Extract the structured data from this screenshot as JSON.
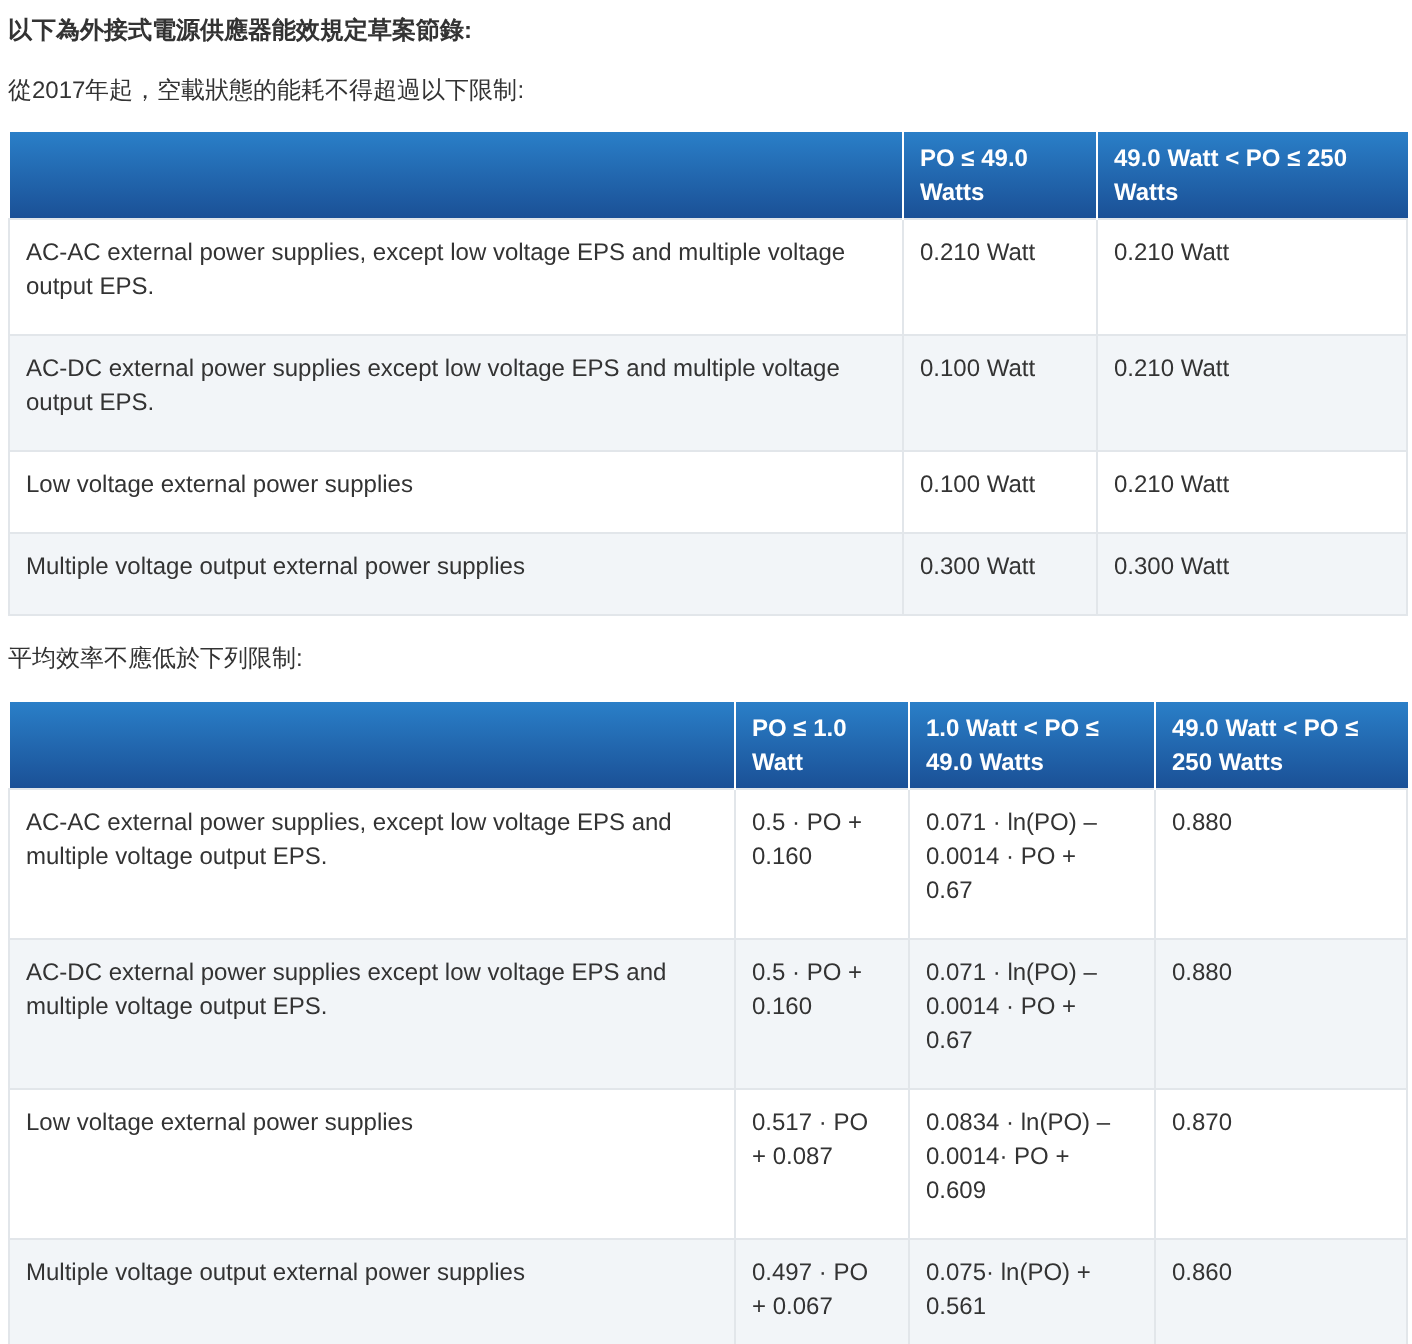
{
  "heading": "以下為外接式電源供應器能效規定草案節錄:",
  "sections": [
    {
      "caption": "從2017年起，空載狀態的能耗不得超過以下限制:",
      "table": {
        "columns": [
          "",
          "PO ≤ 49.0 Watts",
          "49.0 Watt < PO ≤ 250 Watts"
        ],
        "rows": [
          [
            "AC-AC external power supplies, except low voltage EPS and multiple voltage output EPS.",
            "0.210 Watt",
            "0.210 Watt"
          ],
          [
            "AC-DC external power supplies except low voltage EPS and multiple voltage output EPS.",
            "0.100 Watt",
            "0.210 Watt"
          ],
          [
            "Low voltage external power supplies",
            "0.100 Watt",
            "0.210 Watt"
          ],
          [
            "Multiple voltage output external power supplies",
            "0.300 Watt",
            "0.300 Watt"
          ]
        ]
      }
    },
    {
      "caption": "平均效率不應低於下列限制:",
      "table": {
        "columns": [
          "",
          "PO ≤ 1.0 Watt",
          "1.0 Watt < PO ≤ 49.0 Watts",
          "49.0 Watt < PO ≤ 250 Watts"
        ],
        "rows": [
          [
            "AC-AC external power supplies, except low voltage EPS and multiple voltage output EPS.",
            "0.5 · PO + 0.160",
            "0.071 · ln(PO) – 0.0014 · PO + 0.67",
            "0.880"
          ],
          [
            "AC-DC external power supplies except low voltage EPS and multiple voltage output EPS.",
            "0.5 · PO + 0.160",
            "0.071 · ln(PO) – 0.0014 · PO + 0.67",
            "0.880"
          ],
          [
            "Low voltage external power supplies",
            "0.517 · PO + 0.087",
            "0.0834 · ln(PO) – 0.0014· PO + 0.609",
            "0.870"
          ],
          [
            "Multiple voltage output external power supplies",
            "0.497 · PO + 0.067",
            "0.075· ln(PO) + 0.561",
            "0.860"
          ]
        ]
      }
    }
  ]
}
